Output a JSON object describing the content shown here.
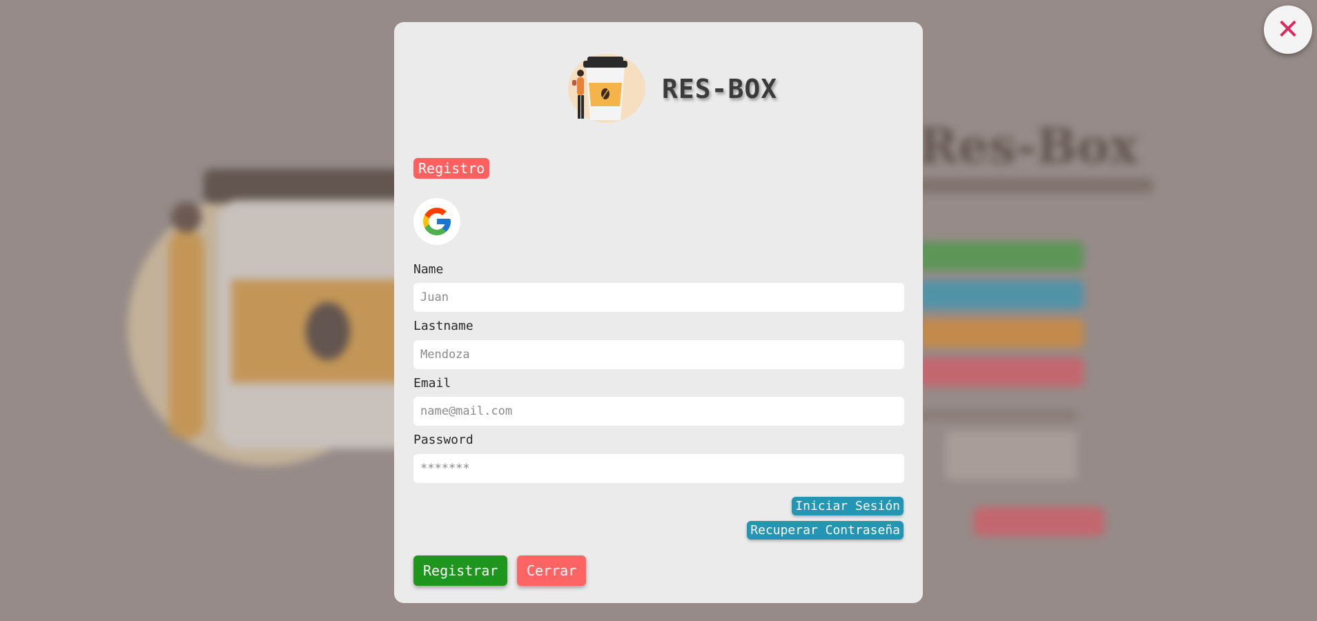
{
  "background": {
    "title": "Res-Box",
    "button_colors": [
      "#2f9e2f",
      "#1a9ac0",
      "#e88a1a",
      "#e84a5a"
    ]
  },
  "modal": {
    "brand": {
      "name": "RES-BOX",
      "logo_icon": "coffee-cup-illustration"
    },
    "badge": "Registro",
    "google_icon": "google-icon",
    "fields": [
      {
        "label": "Name",
        "placeholder": "Juan"
      },
      {
        "label": "Lastname",
        "placeholder": "Mendoza"
      },
      {
        "label": "Email",
        "placeholder": "name@mail.com"
      },
      {
        "label": "Password",
        "placeholder": "*******"
      }
    ],
    "links": {
      "login": "Iniciar Sesión",
      "recover": "Recuperar Contraseña"
    },
    "actions": {
      "register": "Registrar",
      "close": "Cerrar"
    }
  },
  "close_fab": {
    "symbol": "✕"
  },
  "colors": {
    "badge": "#ff5f5f",
    "link": "#2496b4",
    "register": "#1e961e",
    "close": "#ff6464",
    "close_icon": "#e0245e"
  }
}
